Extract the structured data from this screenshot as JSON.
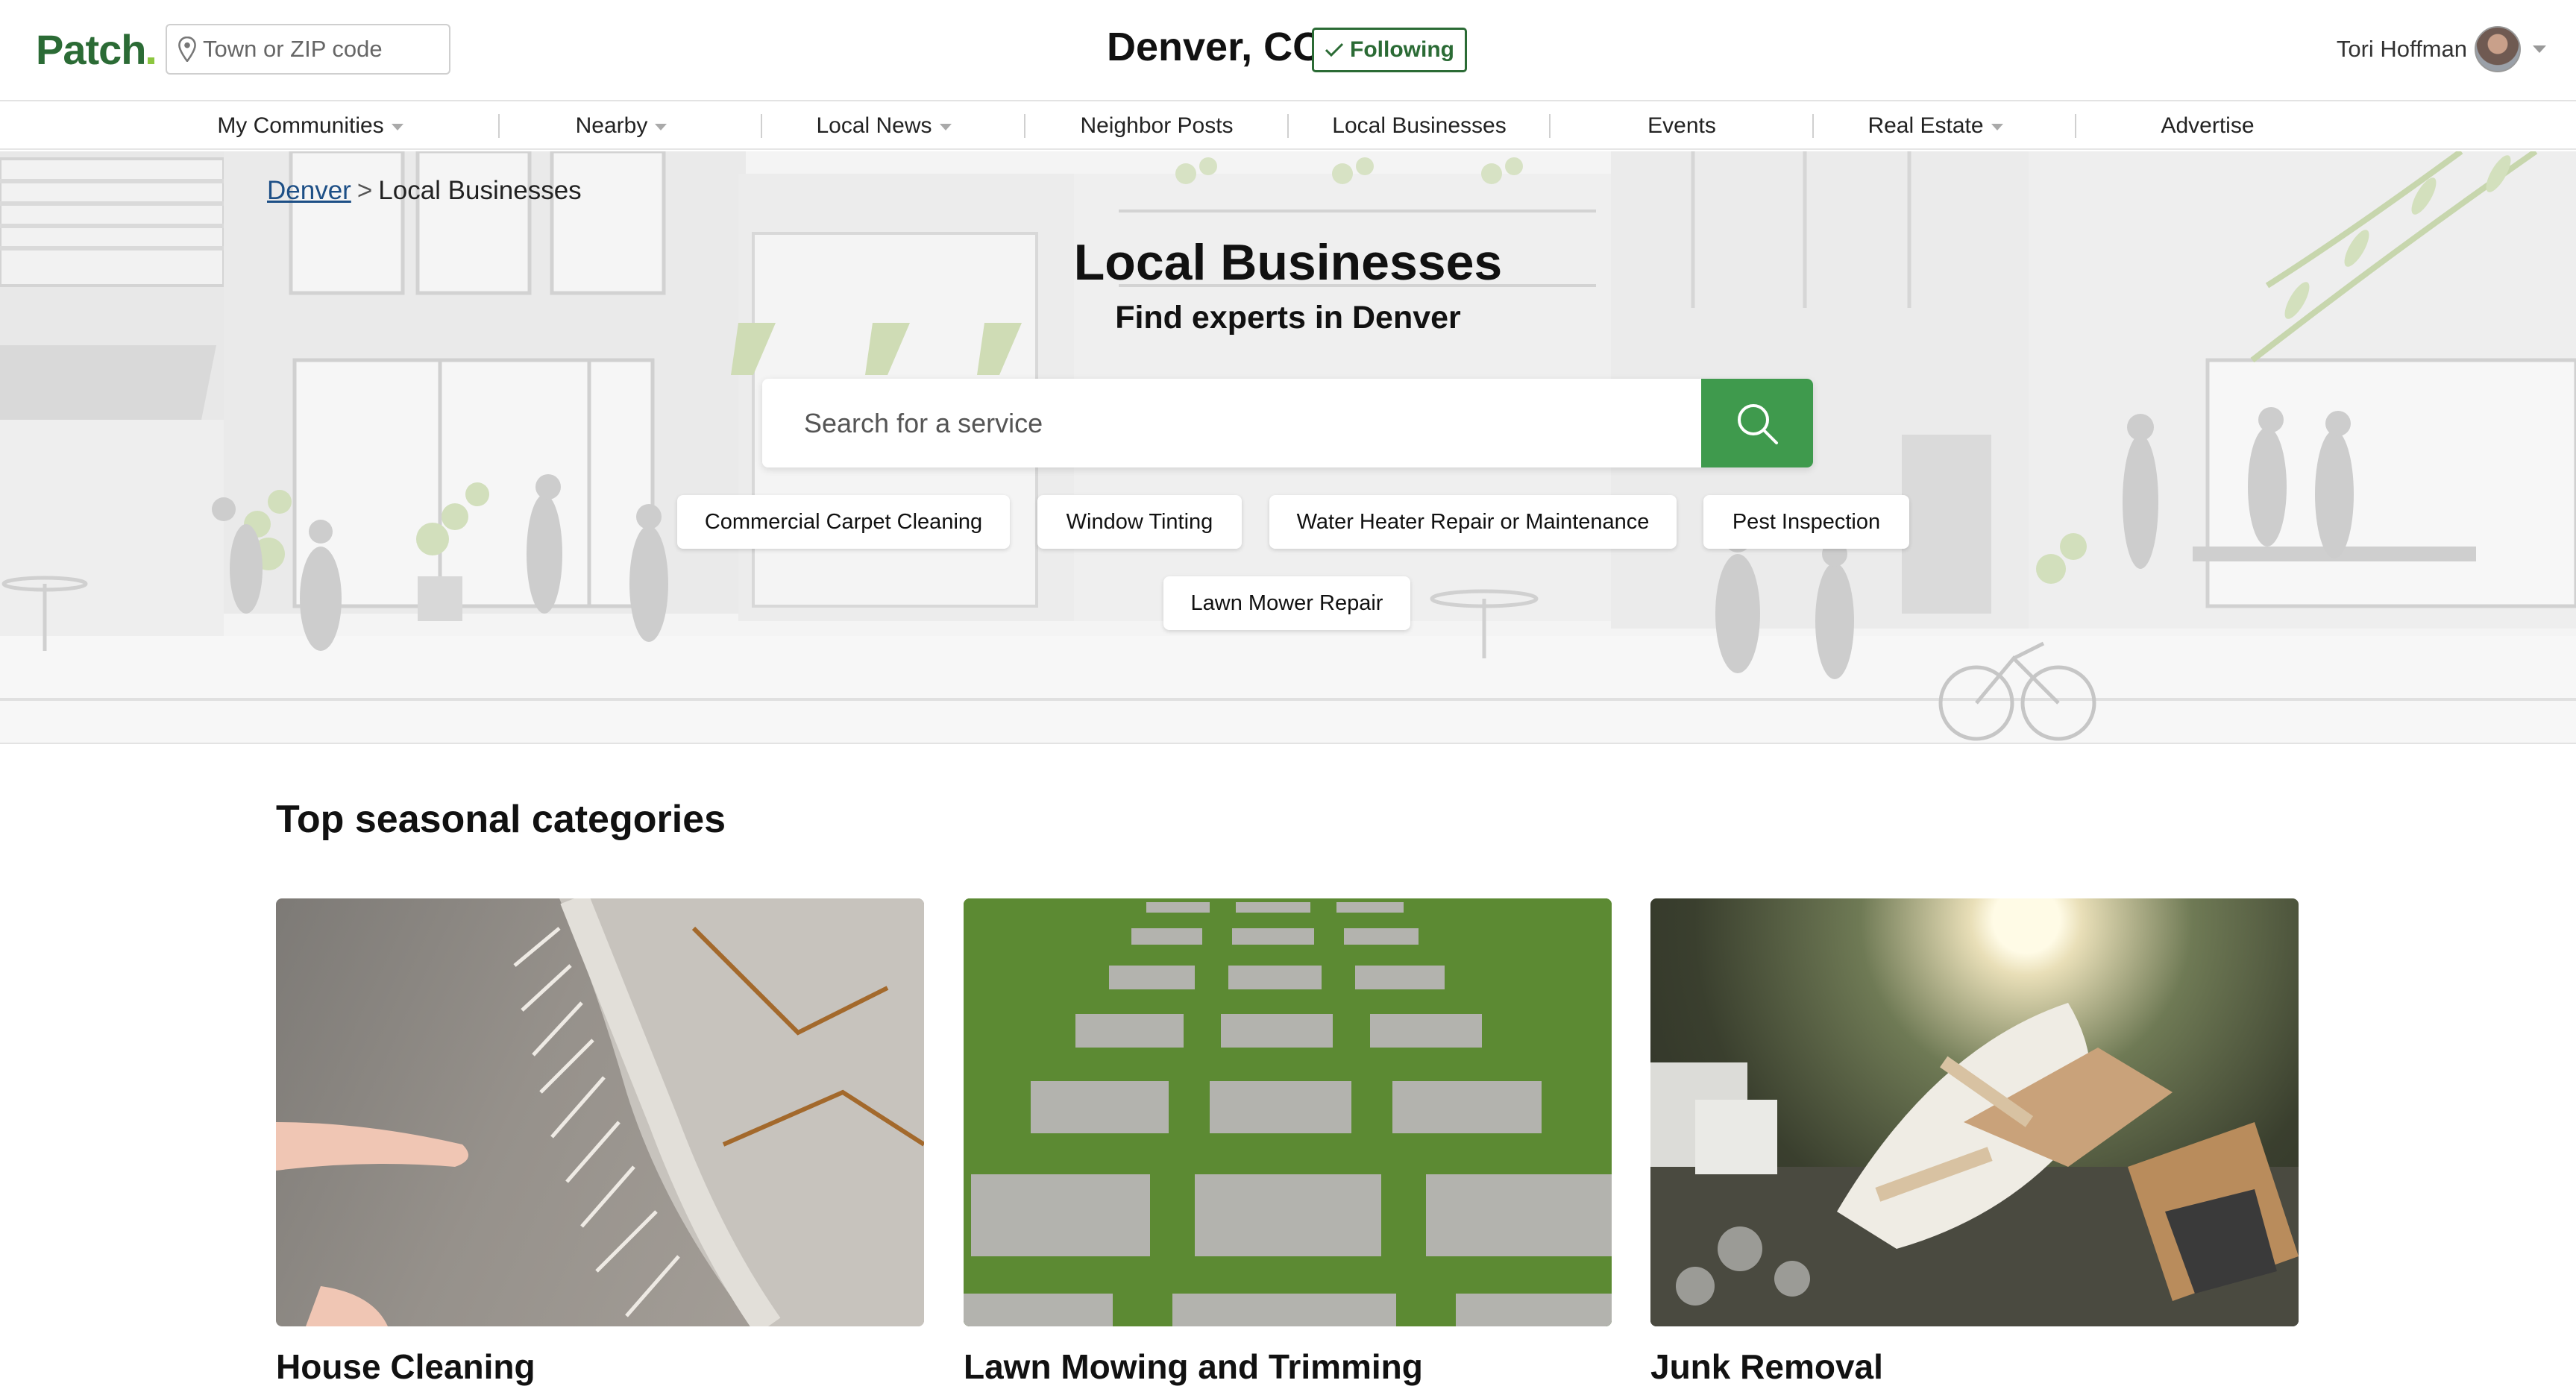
{
  "header": {
    "logo": "Patch",
    "location_placeholder": "Town or ZIP code",
    "city": "Denver, CO",
    "follow_label": "Following",
    "user_name": "Tori Hoffman"
  },
  "nav": {
    "items": [
      {
        "label": "My Communities",
        "dropdown": true
      },
      {
        "label": "Nearby",
        "dropdown": true
      },
      {
        "label": "Local News",
        "dropdown": true
      },
      {
        "label": "Neighbor Posts",
        "dropdown": false
      },
      {
        "label": "Local Businesses",
        "dropdown": false
      },
      {
        "label": "Events",
        "dropdown": false
      },
      {
        "label": "Real Estate",
        "dropdown": true
      },
      {
        "label": "Advertise",
        "dropdown": false
      }
    ]
  },
  "breadcrumb": {
    "parent": "Denver",
    "separator": ">",
    "current": "Local Businesses"
  },
  "hero": {
    "title": "Local Businesses",
    "subtitle": "Find experts in Denver",
    "search_placeholder": "Search for a service",
    "chips": [
      "Commercial Carpet Cleaning",
      "Window Tinting",
      "Water Heater Repair or Maintenance",
      "Pest Inspection",
      "Lawn Mower Repair"
    ]
  },
  "seasonal": {
    "title": "Top seasonal categories",
    "cards": [
      {
        "label": "House Cleaning"
      },
      {
        "label": "Lawn Mowing and Trimming"
      },
      {
        "label": "Junk Removal"
      }
    ]
  },
  "colors": {
    "brand_green": "#2b6b35",
    "search_button": "#3f9a4d",
    "link_blue": "#1d4f86"
  }
}
